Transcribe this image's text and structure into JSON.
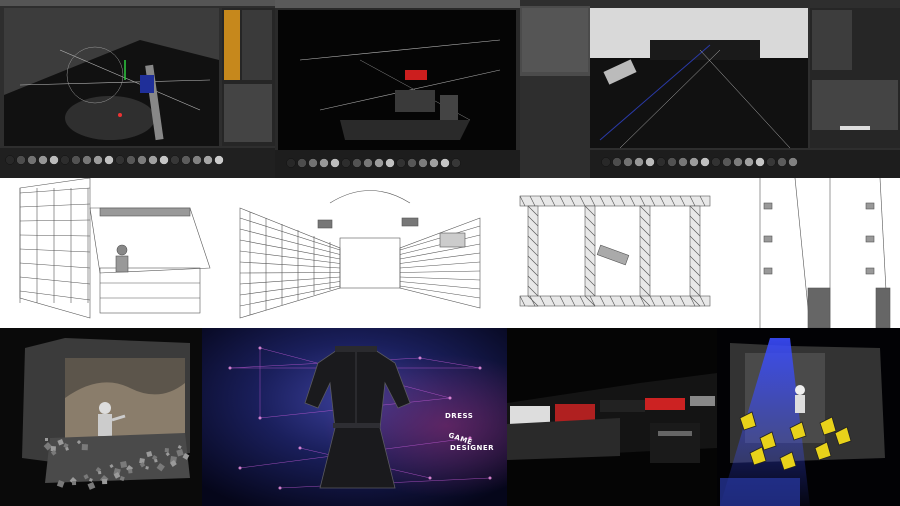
{
  "collage": {
    "row1": {
      "screens": [
        {
          "name": "3d-viewport-perspective"
        },
        {
          "name": "3d-viewport-camera"
        },
        {
          "name": "3d-viewport-stage"
        }
      ]
    },
    "row2": {
      "sketches": [
        {
          "name": "wireframe-dj-booth"
        },
        {
          "name": "wireframe-tunnel"
        },
        {
          "name": "wireframe-truss-frame"
        },
        {
          "name": "wireframe-wall-lights"
        }
      ]
    },
    "row3": {
      "renders": [
        {
          "name": "render-rock-booth"
        },
        {
          "name": "render-dress"
        },
        {
          "name": "render-club-interior"
        },
        {
          "name": "render-projection-booth"
        }
      ],
      "dress_words": [
        "DRESS",
        "GAME",
        "DESIGNER"
      ]
    }
  },
  "colors": {
    "ui_dark": "#2b2b2b",
    "ui_panel": "#4a4a4a",
    "accent_orange": "#e39a1b",
    "sketch_bg": "#ffffff",
    "render_blue": "#1b2a6b"
  }
}
